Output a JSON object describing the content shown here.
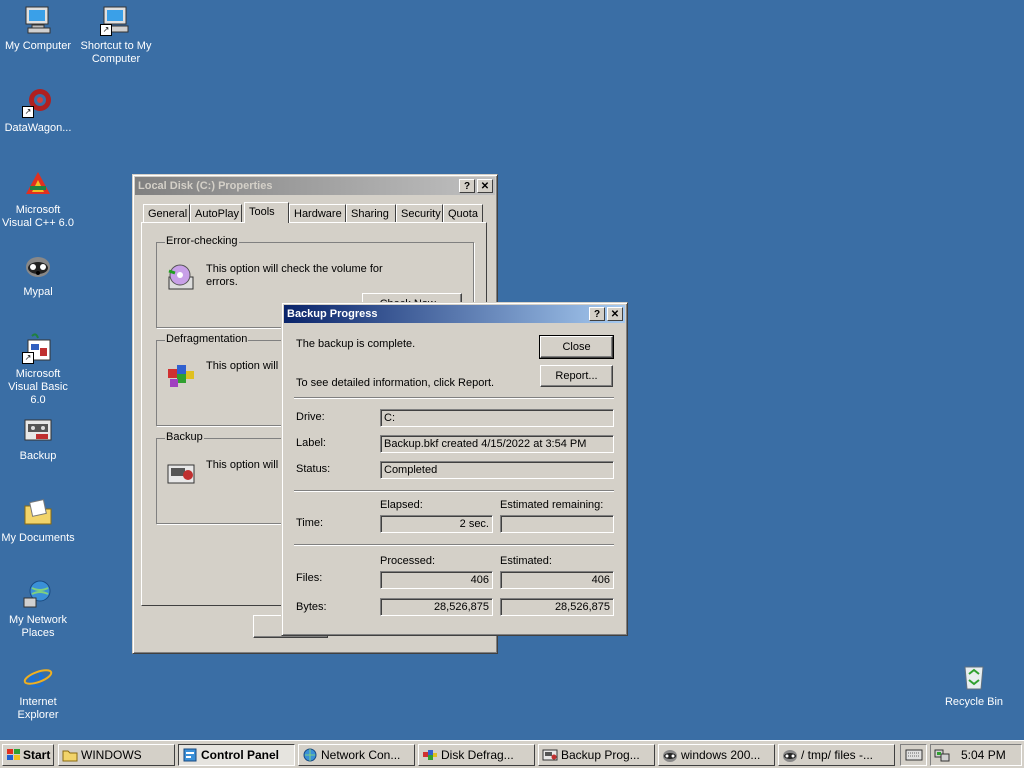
{
  "desktop": {
    "icons": [
      {
        "label": "My Computer",
        "icon": "computer-icon"
      },
      {
        "label": "Shortcut to My Computer",
        "icon": "computer-shortcut-icon"
      },
      {
        "label": "DataWagon...",
        "icon": "datawagon-icon"
      },
      {
        "label": "Microsoft Visual C++ 6.0",
        "icon": "visual-cpp-icon"
      },
      {
        "label": "Mypal",
        "icon": "mypal-icon"
      },
      {
        "label": "Microsoft Visual Basic 6.0",
        "icon": "visual-basic-icon"
      },
      {
        "label": "Backup",
        "icon": "backup-icon"
      },
      {
        "label": "My Documents",
        "icon": "folder-documents-icon"
      },
      {
        "label": "My Network Places",
        "icon": "network-icon"
      },
      {
        "label": "Internet Explorer",
        "icon": "ie-icon"
      },
      {
        "label": "Recycle Bin",
        "icon": "recycle-bin-icon"
      }
    ]
  },
  "properties": {
    "title": "Local Disk (C:) Properties",
    "tabs": [
      "General",
      "AutoPlay",
      "Tools",
      "Hardware",
      "Sharing",
      "Security",
      "Quota"
    ],
    "selected_tab": "Tools",
    "error_group": "Error-checking",
    "error_text_1": "This option will check the volume for",
    "error_text_2": "errors.",
    "check_button": "Check Now...",
    "defrag_group": "Defragmentation",
    "defrag_text": "This option will d",
    "backup_group": "Backup",
    "backup_text": "This option will b"
  },
  "backup_progress": {
    "title": "Backup Progress",
    "message": "The backup is complete.",
    "report_hint": "To see detailed information, click Report.",
    "close_button": "Close",
    "report_button": "Report...",
    "drive_label": "Drive:",
    "drive_value": "C:",
    "label_label": "Label:",
    "label_value": "Backup.bkf created 4/15/2022 at 3:54 PM",
    "status_label": "Status:",
    "status_value": "Completed",
    "time_label": "Time:",
    "elapsed_header": "Elapsed:",
    "remaining_header": "Estimated remaining:",
    "elapsed_value": "2 sec.",
    "remaining_value": "",
    "processed_header": "Processed:",
    "estimated_header": "Estimated:",
    "files_label": "Files:",
    "files_processed": "406",
    "files_estimated": "406",
    "bytes_label": "Bytes:",
    "bytes_processed": "28,526,875",
    "bytes_estimated": "28,526,875"
  },
  "taskbar": {
    "start": "Start",
    "items": [
      {
        "label": "WINDOWS",
        "icon": "folder-icon"
      },
      {
        "label": "Control Panel",
        "icon": "control-panel-icon"
      },
      {
        "label": "Network Con...",
        "icon": "network-connections-icon"
      },
      {
        "label": "Disk Defrag...",
        "icon": "defrag-icon"
      },
      {
        "label": "Backup Prog...",
        "icon": "backup-icon"
      },
      {
        "label": "windows 200...",
        "icon": "mypal-icon"
      },
      {
        "label": "/ tmp/ files -...",
        "icon": "mypal-icon"
      }
    ],
    "clock": "5:04 PM"
  },
  "colors": {
    "desktop": "#3a6ea5",
    "face": "#d4d0c8",
    "active_title": "#0a246a",
    "inactive_title": "#808080"
  }
}
